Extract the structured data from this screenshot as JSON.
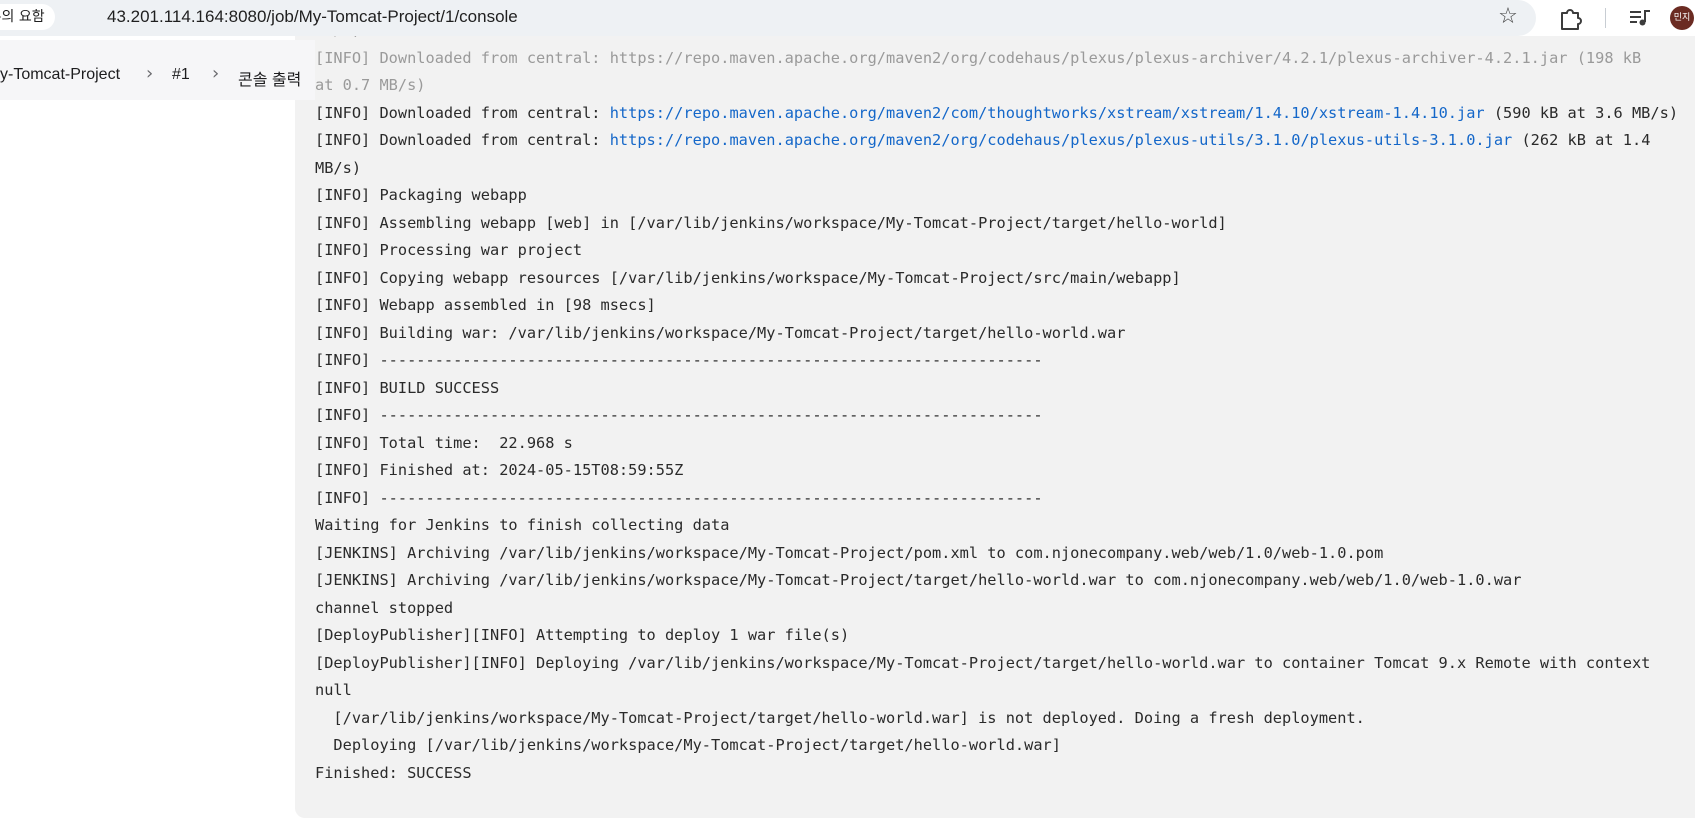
{
  "browser": {
    "security_label": "주의 요함",
    "url": "43.201.114.164:8080/job/My-Tomcat-Project/1/console",
    "avatar_text": "민지"
  },
  "breadcrumb": {
    "items": [
      "y-Tomcat-Project",
      "#1",
      "콘솔 출력"
    ],
    "separator": ">"
  },
  "console": {
    "lines": [
      {
        "type": "faded",
        "text": "MB/s)"
      },
      {
        "type": "faded",
        "text": "[INFO] Downloaded from central: https://repo.maven.apache.org/maven2/org/codehaus/plexus/plexus-archiver/4.2.1/plexus-archiver-4.2.1.jar (198 kB"
      },
      {
        "type": "faded",
        "text": "at 0.7 MB/s)"
      },
      {
        "type": "link",
        "prefix": "[INFO] Downloaded from central: ",
        "link": "https://repo.maven.apache.org/maven2/com/thoughtworks/xstream/xstream/1.4.10/xstream-1.4.10.jar",
        "suffix": " (590 kB at 3.6 MB/s)"
      },
      {
        "type": "link",
        "prefix": "[INFO] Downloaded from central: ",
        "link": "https://repo.maven.apache.org/maven2/org/codehaus/plexus/plexus-utils/3.1.0/plexus-utils-3.1.0.jar",
        "suffix": " (262 kB at 1.4"
      },
      {
        "type": "text",
        "text": "MB/s)"
      },
      {
        "type": "text",
        "text": "[INFO] Packaging webapp"
      },
      {
        "type": "text",
        "text": "[INFO] Assembling webapp [web] in [/var/lib/jenkins/workspace/My-Tomcat-Project/target/hello-world]"
      },
      {
        "type": "text",
        "text": "[INFO] Processing war project"
      },
      {
        "type": "text",
        "text": "[INFO] Copying webapp resources [/var/lib/jenkins/workspace/My-Tomcat-Project/src/main/webapp]"
      },
      {
        "type": "text",
        "text": "[INFO] Webapp assembled in [98 msecs]"
      },
      {
        "type": "text",
        "text": "[INFO] Building war: /var/lib/jenkins/workspace/My-Tomcat-Project/target/hello-world.war"
      },
      {
        "type": "text",
        "text": "[INFO] ------------------------------------------------------------------------"
      },
      {
        "type": "text",
        "text": "[INFO] BUILD SUCCESS"
      },
      {
        "type": "text",
        "text": "[INFO] ------------------------------------------------------------------------"
      },
      {
        "type": "text",
        "text": "[INFO] Total time:  22.968 s"
      },
      {
        "type": "text",
        "text": "[INFO] Finished at: 2024-05-15T08:59:55Z"
      },
      {
        "type": "text",
        "text": "[INFO] ------------------------------------------------------------------------"
      },
      {
        "type": "text",
        "text": "Waiting for Jenkins to finish collecting data"
      },
      {
        "type": "text",
        "text": "[JENKINS] Archiving /var/lib/jenkins/workspace/My-Tomcat-Project/pom.xml to com.njonecompany.web/web/1.0/web-1.0.pom"
      },
      {
        "type": "text",
        "text": "[JENKINS] Archiving /var/lib/jenkins/workspace/My-Tomcat-Project/target/hello-world.war to com.njonecompany.web/web/1.0/web-1.0.war"
      },
      {
        "type": "text",
        "text": "channel stopped"
      },
      {
        "type": "text",
        "text": "[DeployPublisher][INFO] Attempting to deploy 1 war file(s)"
      },
      {
        "type": "text",
        "text": "[DeployPublisher][INFO] Deploying /var/lib/jenkins/workspace/My-Tomcat-Project/target/hello-world.war to container Tomcat 9.x Remote with context"
      },
      {
        "type": "text",
        "text": "null"
      },
      {
        "type": "text",
        "text": "  [/var/lib/jenkins/workspace/My-Tomcat-Project/target/hello-world.war] is not deployed. Doing a fresh deployment."
      },
      {
        "type": "text",
        "text": "  Deploying [/var/lib/jenkins/workspace/My-Tomcat-Project/target/hello-world.war]"
      },
      {
        "type": "text",
        "text": "Finished: SUCCESS"
      }
    ]
  }
}
